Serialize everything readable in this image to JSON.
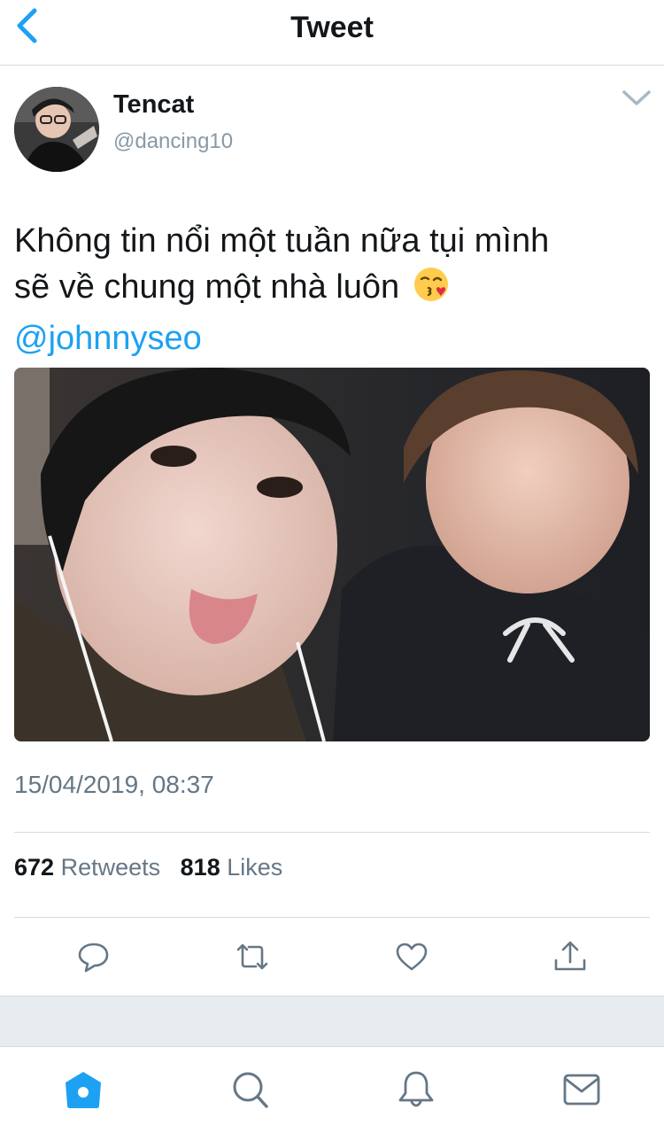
{
  "nav": {
    "title": "Tweet"
  },
  "tweet": {
    "display_name": "Tencat",
    "handle": "@dancing10",
    "text_line1": "Không tin nổi một tuần nữa tụi mình",
    "text_line2": "sẽ về chung một nhà luôn",
    "emoji": "😘",
    "mention": "@johnnyseo",
    "timestamp": "15/04/2019, 08:37",
    "retweets_count": "672",
    "retweets_label": "Retweets",
    "likes_count": "818",
    "likes_label": "Likes"
  },
  "icons": {
    "back": "chevron-left-icon",
    "options": "chevron-down-icon",
    "reply": "reply-icon",
    "retweet": "retweet-icon",
    "like": "heart-icon",
    "share": "share-icon",
    "home": "home-icon",
    "search": "search-icon",
    "notifications": "bell-icon",
    "messages": "mail-icon"
  },
  "colors": {
    "accent": "#1da1f2",
    "secondary_text": "#657786",
    "icon_gray": "#657786"
  }
}
